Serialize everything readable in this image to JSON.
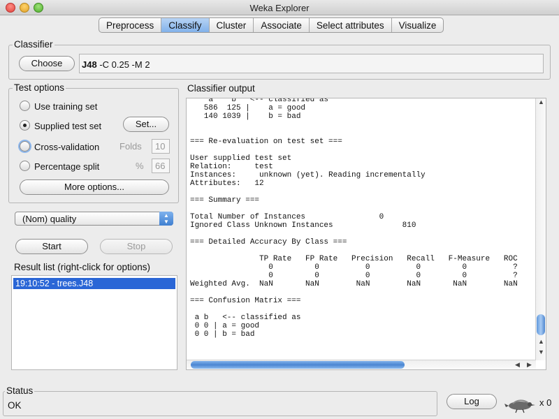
{
  "window": {
    "title": "Weka Explorer"
  },
  "tabs": [
    "Preprocess",
    "Classify",
    "Cluster",
    "Associate",
    "Select attributes",
    "Visualize"
  ],
  "active_tab": "Classify",
  "classifier": {
    "legend": "Classifier",
    "choose_label": "Choose",
    "name": "J48",
    "options": " -C 0.25 -M 2"
  },
  "test_options": {
    "legend": "Test options",
    "use_training_set": "Use training set",
    "supplied_test_set": "Supplied test set",
    "set_button": "Set...",
    "cross_validation": "Cross-validation",
    "folds_label": "Folds",
    "folds_value": "10",
    "percentage_split": "Percentage split",
    "percent_label": "%",
    "percent_value": "66",
    "more_options": "More options...",
    "selected": "Supplied test set"
  },
  "class_select": {
    "value": "(Nom) quality"
  },
  "actions": {
    "start": "Start",
    "stop": "Stop"
  },
  "result_list": {
    "legend": "Result list (right-click for options)",
    "items": [
      "19:10:52 - trees.J48"
    ]
  },
  "output": {
    "legend": "Classifier output",
    "text": "    a    b   <-- classified as\n   586  125 |    a = good\n   140 1039 |    b = bad\n\n\n=== Re-evaluation on test set ===\n\nUser supplied test set\nRelation:     test\nInstances:     unknown (yet). Reading incrementally\nAttributes:   12\n\n=== Summary ===\n\nTotal Number of Instances                0\nIgnored Class Unknown Instances               810\n\n=== Detailed Accuracy By Class ===\n\n               TP Rate   FP Rate   Precision   Recall   F-Measure   ROC\n                 0         0          0          0         0          ?\n                 0         0          0          0         0          ?\nWeighted Avg.  NaN       NaN        NaN        NaN       NaN        NaN\n\n=== Confusion Matrix ===\n\n a b   <-- classified as\n 0 0 | a = good\n 0 0 | b = bad"
  },
  "status": {
    "legend": "Status",
    "text": "OK"
  },
  "log": {
    "label": "Log",
    "count": "x 0"
  },
  "colors": {
    "accent": "#2a66d6",
    "tab_active": "#8fbbee",
    "window_bg": "#ececec"
  }
}
